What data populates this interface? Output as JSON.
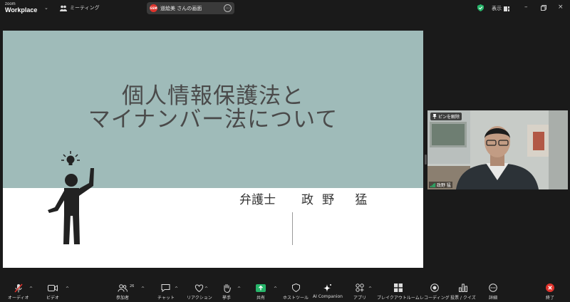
{
  "app": {
    "logo_line1": "zoom",
    "logo_line2": "Workplace"
  },
  "topbar": {
    "meeting_label": "ミーティング",
    "share_badge": "GSM",
    "share_label": "道絵美 さんの画面",
    "view_label": "表示"
  },
  "slide": {
    "title_line1": "個人情報保護法と",
    "title_line2": "マイナンバー法について",
    "presenter_title": "弁護士",
    "presenter_name": "政野 猛",
    "bg_top": "#9fbbb9"
  },
  "video": {
    "pin_label": "ピンを解除",
    "participant_name": "政野 猛"
  },
  "toolbar": {
    "audio": "オーディオ",
    "video": "ビデオ",
    "participants": "参加者",
    "participants_count": "26",
    "chat": "チャット",
    "reactions": "リアクション",
    "raise_hand": "挙手",
    "share": "共有",
    "host_tools": "ホストツール",
    "ai_companion": "AI Companion",
    "apps": "アプリ",
    "breakout": "ブレイクアウトルーム",
    "record": "レコーディング",
    "polls": "投票 / クイズ",
    "more": "詳細",
    "end": "終了"
  },
  "colors": {
    "accent_green": "#27b56a",
    "end_red": "#e0342d",
    "dark_bg": "#1a1a1a"
  }
}
